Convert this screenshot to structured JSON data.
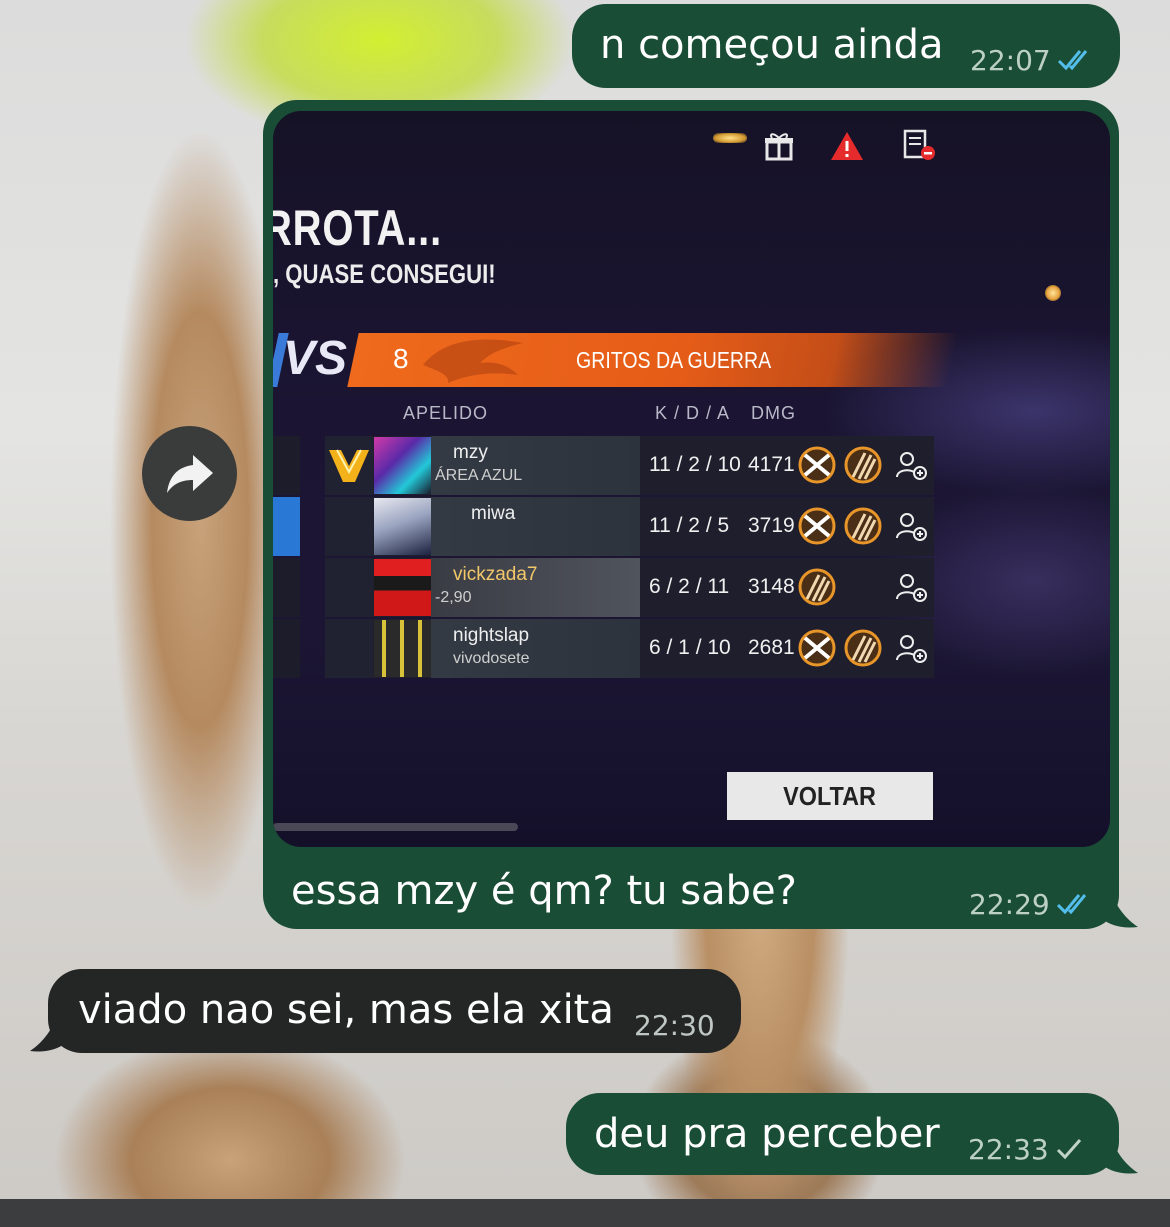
{
  "messages": [
    {
      "id": "m1",
      "direction": "outgoing",
      "text": "n começou ainda",
      "time": "22:07",
      "status": "read"
    },
    {
      "id": "m2",
      "direction": "outgoing",
      "type": "image",
      "caption": "essa mzy é qm? tu sabe?",
      "time": "22:29",
      "status": "read"
    },
    {
      "id": "m3",
      "direction": "incoming",
      "text": "viado nao sei, mas ela xita",
      "time": "22:30"
    },
    {
      "id": "m4",
      "direction": "outgoing",
      "text": "deu pra perceber",
      "time": "22:33",
      "status": "sent"
    }
  ],
  "game": {
    "title": "RROTA...",
    "subtitle": ", QUASE CONSEGUI!",
    "vs": "VS",
    "team_score": "8",
    "team_name": "GRITOS DA GUERRA",
    "headers": {
      "nickname": "APELIDO",
      "kda": "K / D / A",
      "dmg": "DMG"
    },
    "players": [
      {
        "name": "mzy",
        "sub": "ÁREA AZUL",
        "kda": "11 / 2 / 10",
        "dmg": "4171"
      },
      {
        "name": "miwa",
        "sub": "",
        "kda": "11 / 2 / 5",
        "dmg": "3719"
      },
      {
        "name": "vickzada7",
        "sub": "-2,90",
        "kda": "6 / 2 / 11",
        "dmg": "3148"
      },
      {
        "name": "nightslap",
        "sub": "vivodosete",
        "kda": "6 / 1 / 10",
        "dmg": "2681"
      }
    ],
    "back_button": "VOLTAR"
  },
  "colors": {
    "outgoing_bubble": "#1a4d35",
    "incoming_bubble": "#242626",
    "read_ticks": "#53bdeb",
    "banner": "#ef6a1c"
  },
  "icons": [
    "forward-icon",
    "gift-icon",
    "warning-icon",
    "report-icon",
    "add-friend-icon",
    "double-check-icon",
    "single-check-icon"
  ]
}
